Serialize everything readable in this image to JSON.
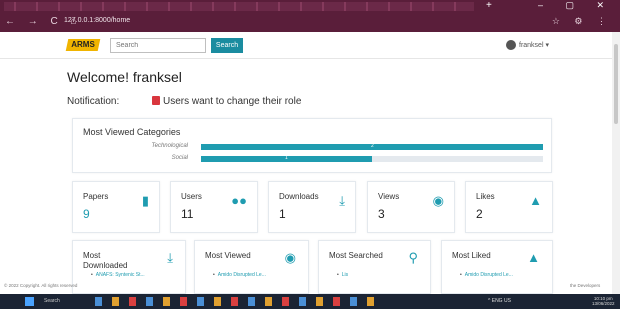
{
  "browser": {
    "url": "127.0.0.1:8000/home",
    "nav_icons": "← → C ⌂",
    "new_tab": "+",
    "window_controls": "– ▢ ✕",
    "toolbar_icons": "☆ ⚙ ⋮"
  },
  "navbar": {
    "logo_text": "ARMS",
    "search_placeholder": "Search",
    "search_button": "Search",
    "user_label": "franksel ▾"
  },
  "welcome": "Welcome! franksel",
  "notification": {
    "label": "Notification:",
    "text": "Users want to change their role"
  },
  "categories": {
    "title": "Most Viewed Categories",
    "items": [
      {
        "label": "Technological",
        "value": 2,
        "fraction": 1.0
      },
      {
        "label": "Social",
        "value": 1,
        "fraction": 0.5
      }
    ]
  },
  "stats": [
    {
      "name": "Papers",
      "value": "9",
      "icon": "file-icon"
    },
    {
      "name": "Users",
      "value": "11",
      "icon": "users-icon"
    },
    {
      "name": "Downloads",
      "value": "1",
      "icon": "download-icon"
    },
    {
      "name": "Views",
      "value": "3",
      "icon": "eye-icon"
    },
    {
      "name": "Likes",
      "value": "2",
      "icon": "thumbs-up-icon"
    }
  ],
  "most": [
    {
      "title": "Most Downloaded",
      "item": "ANAFS: Syntenic St..."
    },
    {
      "title": "Most Viewed",
      "item": "Amido Disrupted Le..."
    },
    {
      "title": "Most Searched",
      "item": "Lis"
    },
    {
      "title": "Most Liked",
      "item": "Amido Disrupted Le..."
    }
  ],
  "footer": {
    "left": "© 2022 Copyright. All rights reserved",
    "right": "the Developers"
  },
  "taskbar": {
    "search": "Search",
    "tray": "^ ENG US",
    "time": "10:10 pm",
    "date": "13/06/2022"
  },
  "colors": {
    "accent": "#1f9cb0",
    "browser_frame": "#5a1e3a",
    "taskbar": "#1b2434",
    "logo": "#f0b400",
    "notification": "#d9363e"
  }
}
